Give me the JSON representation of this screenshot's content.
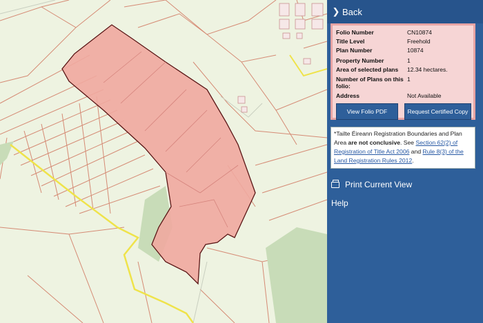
{
  "panel": {
    "back_label": "Back",
    "info": [
      {
        "key": "Folio Number",
        "value": "CN10874"
      },
      {
        "key": "Title Level",
        "value": "Freehold"
      },
      {
        "key": "Plan Number",
        "value": "10874"
      },
      {
        "key": "Property Number",
        "value": "1"
      },
      {
        "key": "Area of selected plans",
        "value": "12.34 hectares."
      },
      {
        "key": "Number of Plans on this folio:",
        "value": "1"
      },
      {
        "key": "Address",
        "value": "Not Available"
      }
    ],
    "view_pdf_label": "View Folio PDF",
    "request_copy_label": "Request Certified Copy",
    "note": {
      "prefix": "*Tailte Éireann Registration Boundaries and Plan Area ",
      "bold": "are not conclusive",
      "mid": ". See ",
      "link1": "Section 62(2) of Registration of Title Act 2006",
      "and": " and ",
      "link2": "Rule 8(3) of the Land Registration Rules 2012",
      "suffix": "."
    },
    "print_label": "Print Current View",
    "help_label": "Help"
  },
  "colors": {
    "panel_bg": "#2e5f9a",
    "parcel_fill": "#f0a8a0",
    "parcel_stroke": "#5a1616",
    "boundary": "#d8806a",
    "road": "#f0e030"
  },
  "icons": [
    "chevron-right-icon",
    "printer-icon"
  ]
}
